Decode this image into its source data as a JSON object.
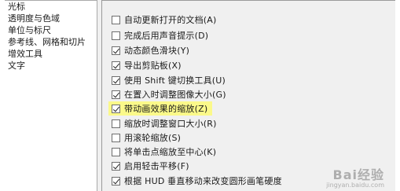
{
  "sidebar": {
    "items": [
      {
        "label": "光标"
      },
      {
        "label": "透明度与色域"
      },
      {
        "label": "单位与标尺"
      },
      {
        "label": "参考线、网格和切片"
      },
      {
        "label": "增效工具"
      },
      {
        "label": "文字"
      }
    ]
  },
  "options": [
    {
      "label": "自动更新打开的文档(A)",
      "checked": false
    },
    {
      "label": "完成后用声音提示(D)",
      "checked": false
    },
    {
      "label": "动态颜色滑块(Y)",
      "checked": true
    },
    {
      "label": "导出剪贴板(X)",
      "checked": true
    },
    {
      "label": "使用 Shift 键切换工具(U)",
      "checked": true
    },
    {
      "label": "在置入时调整图像大小(G)",
      "checked": true
    },
    {
      "label": "带动画效果的缩放(Z)",
      "checked": true,
      "highlighted": true
    },
    {
      "label": "缩放时调整窗口大小(R)",
      "checked": false
    },
    {
      "label": "用滚轮缩放(S)",
      "checked": false
    },
    {
      "label": "将单击点缩放至中心(K)",
      "checked": false
    },
    {
      "label": "启用轻击平移(F)",
      "checked": true
    },
    {
      "label": "根据 HUD 垂直移动来改变圆形画笔硬度",
      "checked": true
    }
  ],
  "watermark": {
    "text": "Bai经验",
    "sub": "jingyan.baidu.com"
  },
  "colors": {
    "highlight": "#fbf98a",
    "panel": "#f0f0f0"
  }
}
